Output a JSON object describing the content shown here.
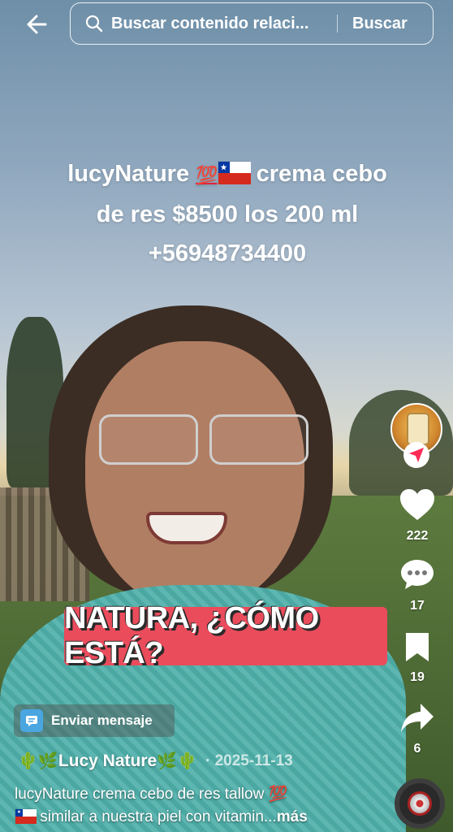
{
  "search": {
    "placeholder": "Buscar contenido relaci...",
    "button_label": "Buscar"
  },
  "video": {
    "overlay_title_line1_a": "lucyNature ",
    "overlay_title_emoji": "💯",
    "overlay_title_line1_b": " crema cebo",
    "overlay_title_line2": "de res $8500 los 200 ml",
    "overlay_title_line3": "+56948734400",
    "caption_banner": "NATURA, ¿CÓMO ESTÁ?"
  },
  "actions": {
    "likes": "222",
    "comments": "17",
    "saves": "19",
    "shares": "6"
  },
  "bottom": {
    "send_message_label": "Enviar mensaje",
    "author_prefix": "🌵🌿",
    "author_name": "Lucy Nature",
    "author_suffix": "🌿🌵",
    "date": "· 2025-11-13",
    "description_line1": "lucyNature crema cebo de res tallow 💯",
    "description_line2": " similar a nuestra piel con vitamin...",
    "more_label": "más"
  },
  "icons": {
    "back": "arrow-left-icon",
    "search": "search-icon",
    "like": "heart-icon",
    "comment": "comment-bubble-icon",
    "save": "bookmark-icon",
    "share": "share-arrow-icon",
    "message": "chat-icon",
    "follow": "follow-icon"
  },
  "colors": {
    "caption_banner": "#ea4c5c",
    "follow_badge": "#fe2c55",
    "message_icon": "#4aa6e0"
  }
}
